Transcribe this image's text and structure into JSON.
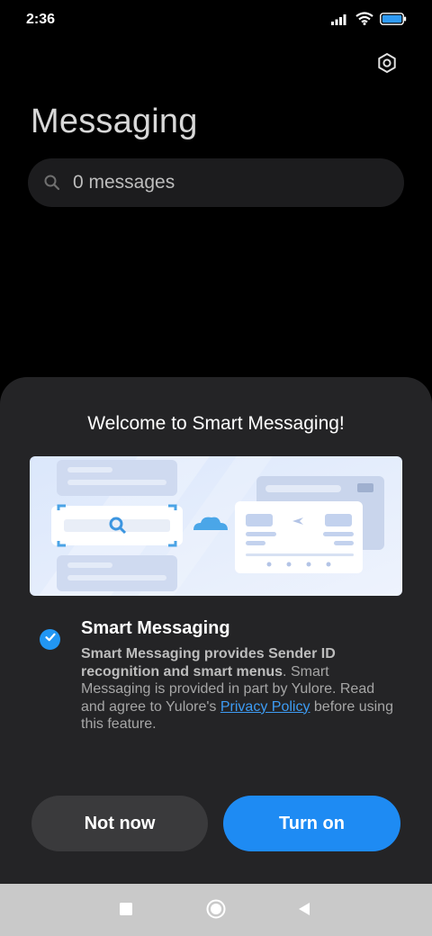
{
  "status_bar": {
    "time": "2:36",
    "icons": [
      "signal-icon",
      "wifi-icon",
      "battery-icon"
    ]
  },
  "header": {
    "title": "Messaging",
    "settings_icon": "gear-icon"
  },
  "search": {
    "icon": "search-icon",
    "text": "0 messages"
  },
  "sheet": {
    "title": "Welcome to Smart Messaging!",
    "option": {
      "checked": true,
      "title": "Smart Messaging",
      "desc_bold": "Smart Messaging provides Sender ID recognition and smart menus",
      "desc_text": ". Smart Messaging is provided in part by Yulore. Read and agree to Yulore's ",
      "link": "Privacy Policy",
      "desc_end": " before using this feature."
    },
    "buttons": {
      "not_now": "Not now",
      "turn_on": "Turn on"
    }
  },
  "nav_bar": {
    "items": [
      "recents-square-icon",
      "home-circle-icon",
      "back-triangle-icon"
    ]
  },
  "colors": {
    "accent": "#1e8bf3",
    "sheet_bg": "#242426",
    "search_bg": "#1c1c1e",
    "nav_bg": "#c9c9c9"
  }
}
